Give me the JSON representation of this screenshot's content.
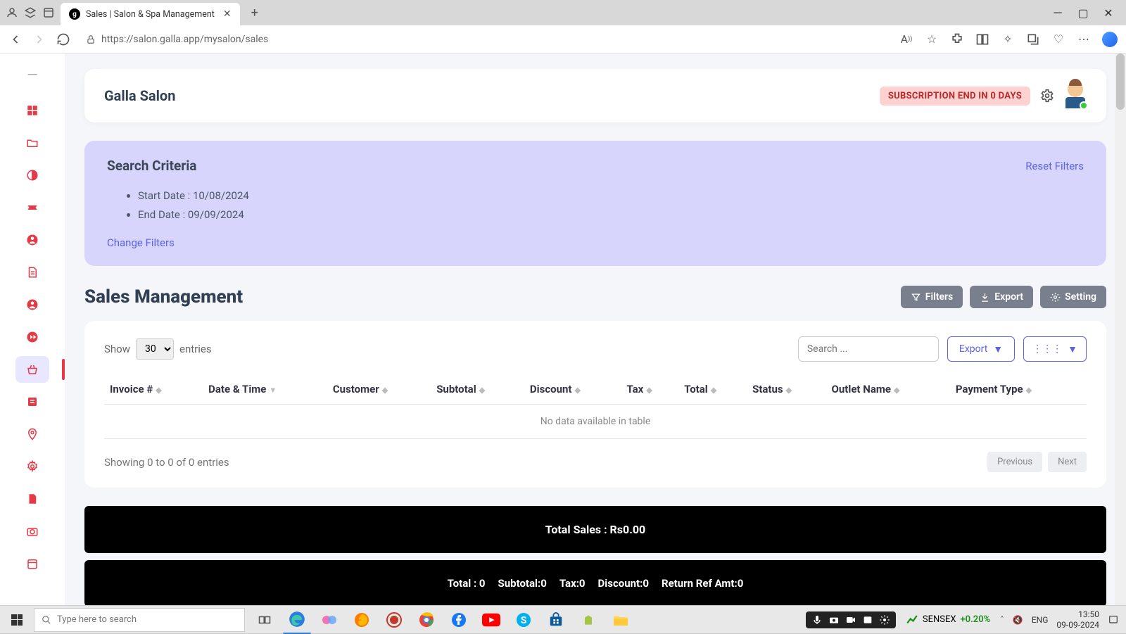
{
  "browser": {
    "tab_title": "Sales | Salon & Spa Management",
    "url": "https://salon.galla.app/mysalon/sales"
  },
  "header": {
    "brand": "Galla Salon",
    "subscription_badge": "SUBSCRIPTION END IN 0 DAYS"
  },
  "criteria": {
    "title": "Search Criteria",
    "reset": "Reset Filters",
    "start_label": "Start Date : 10/08/2024",
    "end_label": "End Date : 09/09/2024",
    "change": "Change Filters"
  },
  "section": {
    "title": "Sales Management",
    "filters_btn": "Filters",
    "export_btn": "Export",
    "setting_btn": "Setting"
  },
  "table": {
    "show_label": "Show",
    "entries_label": "entries",
    "page_size": "30",
    "search_placeholder": "Search ...",
    "export_label": "Export",
    "columns": [
      "Invoice #",
      "Date & Time",
      "Customer",
      "Subtotal",
      "Discount",
      "Tax",
      "Total",
      "Status",
      "Outlet Name",
      "Payment Type"
    ],
    "no_data": "No data available in table",
    "info": "Showing 0 to 0 of 0 entries",
    "prev": "Previous",
    "next": "Next"
  },
  "summary": {
    "total_sales": "Total Sales : Rs0.00",
    "line2": {
      "total": "Total : 0",
      "subtotal": "Subtotal:0",
      "tax": "Tax:0",
      "discount": "Discount:0",
      "return_ref": "Return Ref Amt:0"
    }
  },
  "taskbar": {
    "search_placeholder": "Type here to search",
    "sensex_label": "SENSEX",
    "sensex_change": "+0.20%",
    "lang": "ENG",
    "time": "13:50",
    "date": "09-09-2024"
  }
}
